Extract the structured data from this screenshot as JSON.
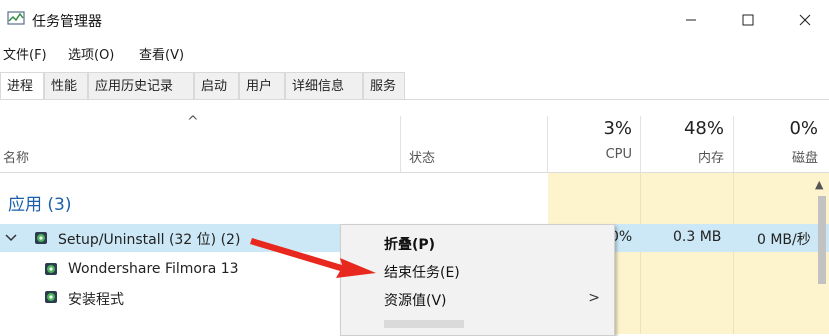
{
  "window": {
    "title": "任务管理器",
    "minimize_icon": "minimize-icon",
    "maximize_icon": "maximize-icon",
    "close_icon": "close-icon"
  },
  "menu": [
    "文件(F)",
    "选项(O)",
    "查看(V)"
  ],
  "tabs": [
    "进程",
    "性能",
    "应用历史记录",
    "启动",
    "用户",
    "详细信息",
    "服务"
  ],
  "active_tab": "进程",
  "columns": {
    "sort_indicator": "^",
    "name": "名称",
    "status": "状态",
    "cpu": {
      "pct": "3%",
      "label": "CPU"
    },
    "memory": {
      "pct": "48%",
      "label": "内存"
    },
    "disk": {
      "pct": "0%",
      "label": "磁盘"
    }
  },
  "group": {
    "label": "应用 (3)"
  },
  "processes": [
    {
      "name": "Setup/Uninstall (32 位) (2)",
      "expand_icon": "chevron-down-icon",
      "cpu": "0%",
      "memory": "0.3 MB",
      "disk": "0 MB/秒",
      "selected": true
    },
    {
      "name": "Wondershare Filmora 13"
    },
    {
      "name": "安装程式"
    }
  ],
  "context_menu": {
    "items": [
      {
        "label": "折叠(P)",
        "bold": true
      },
      {
        "label": "结束任务(E)"
      },
      {
        "label": "资源值(V)",
        "submenu_arrow": ">"
      }
    ]
  },
  "colors": {
    "selection": "#cce8f6",
    "column_tint": "#fdf3cc",
    "group_label": "#1b5faa",
    "annotation_arrow": "#e8281e"
  }
}
